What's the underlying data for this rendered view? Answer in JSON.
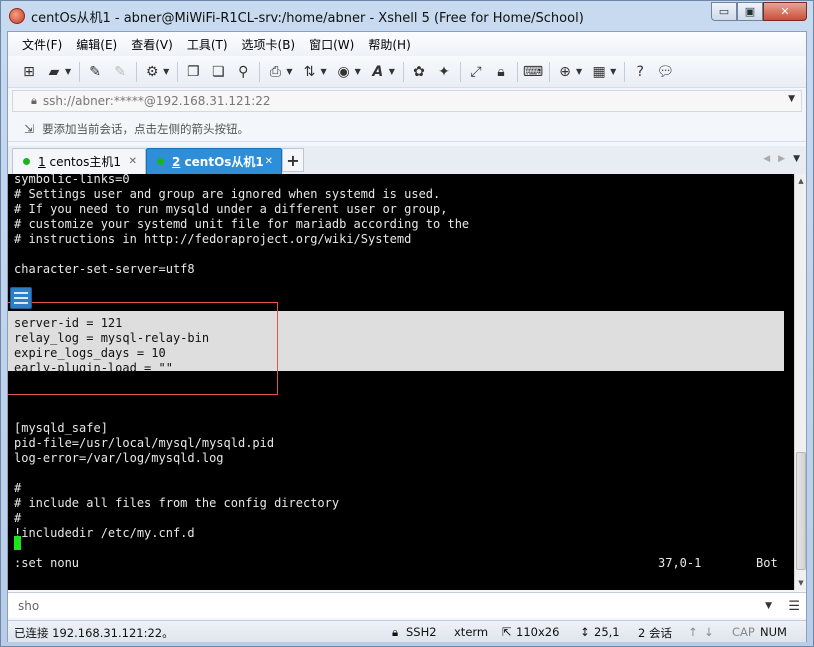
{
  "window": {
    "title": "centOs从机1 - abner@MiWiFi-R1CL-srv:/home/abner - Xshell 5 (Free for Home/School)",
    "controls": {
      "minimize": "▭",
      "restore": "▣",
      "close": "✕"
    }
  },
  "menu": [
    "文件(F)",
    "编辑(E)",
    "查看(V)",
    "工具(T)",
    "选项卡(B)",
    "窗口(W)",
    "帮助(H)"
  ],
  "address": {
    "value": "ssh://abner:*****@192.168.31.121:22"
  },
  "hint": {
    "text": "要添加当前会话，点击左侧的箭头按钮。"
  },
  "tabs": [
    {
      "num": "1",
      "label": "centos主机1"
    },
    {
      "num": "2",
      "label": "centOs从机1"
    }
  ],
  "terminal": {
    "lines": [
      "symbolic-links=0",
      "# Settings user and group are ignored when systemd is used.",
      "# If you need to run mysqld under a different user or group,",
      "# customize your systemd unit file for mariadb according to the",
      "# instructions in http://fedoraproject.org/wiki/Systemd",
      "",
      "character-set-server=utf8",
      "",
      "",
      "server-id = 121",
      "relay_log = mysql-relay-bin",
      "expire_logs_days = 10",
      "early-plugin-load = \"\"",
      "",
      "",
      "",
      "[mysqld_safe]",
      "pid-file=/usr/local/mysql/mysqld.pid",
      "log-error=/var/log/mysqld.log",
      "",
      "#",
      "# include all files from the config directory",
      "#",
      "!includedir /etc/my.cnf.d",
      "",
      ":set nonu"
    ],
    "vim_position": "37,0-1",
    "vim_scroll": "Bot"
  },
  "compose": {
    "value": "sho"
  },
  "status": {
    "connected": "已连接 192.168.31.121:22。",
    "protocol": "SSH2",
    "term": "xterm",
    "size": "110x26",
    "cursor": "25,1",
    "sessions": "2 会话",
    "caps": "CAP",
    "num": "NUM"
  }
}
